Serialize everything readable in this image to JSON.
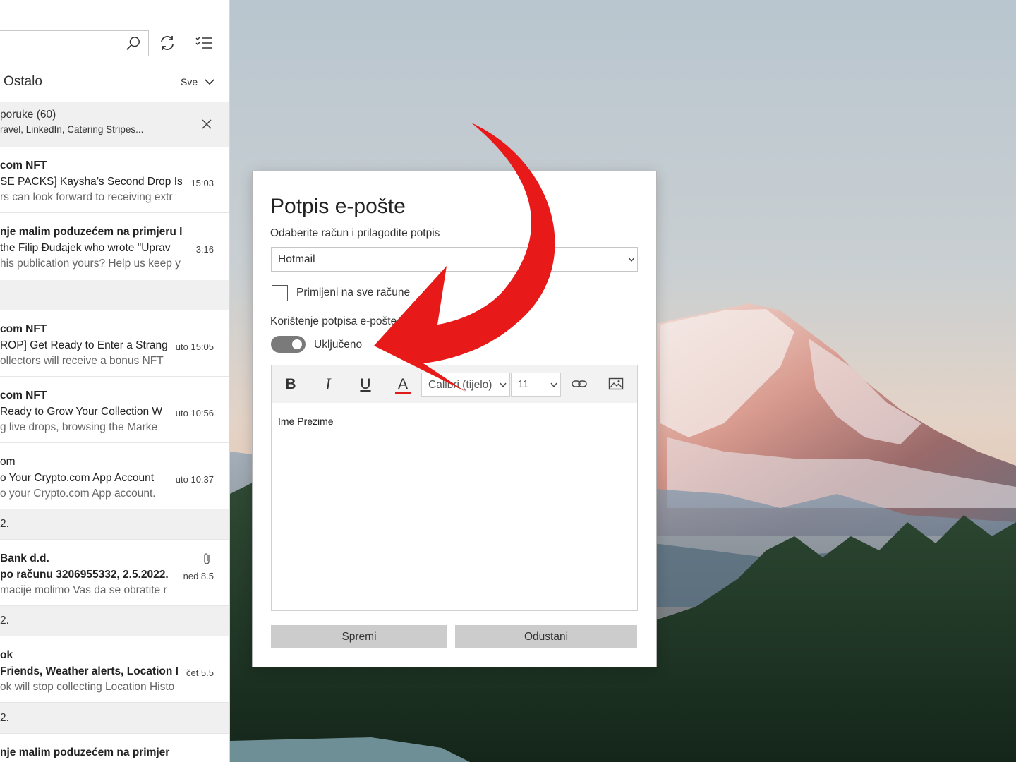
{
  "mail_list": {
    "tab_label": "Ostalo",
    "filter_label": "Sve",
    "grouped": {
      "title": "poruke (60)",
      "senders": "ravel, LinkedIn, Catering Stripes..."
    },
    "items": [
      {
        "sender": "com NFT",
        "subject": "SE PACKS] Kaysha’s Second Drop Is",
        "time": "15:03",
        "preview": "rs can look forward to receiving extr"
      },
      {
        "sender": "nje malim poduzećem na primjeru I",
        "subject": "the Filip Đudajek who wrote \"Uprav",
        "time": "3:16",
        "preview": "his publication yours? Help us keep y"
      },
      {
        "sender": "com NFT",
        "subject": "ROP] Get Ready to Enter a Strang",
        "time": "uto 15:05",
        "preview": "ollectors will receive a bonus NFT"
      },
      {
        "sender": "com NFT",
        "subject": "Ready to Grow Your Collection W",
        "time": "uto 10:56",
        "preview": "g live drops, browsing the Marke"
      },
      {
        "sender": "om",
        "subject": "o Your Crypto.com App Account",
        "time": "uto 10:37",
        "preview": "o your Crypto.com App account."
      },
      {
        "sender": "Bank d.d.",
        "subject": "po računu 3206955332, 2.5.2022.",
        "time": "ned 8.5",
        "preview": "macije molimo Vas da se obratite r"
      },
      {
        "sender": "ok",
        "subject": "Friends, Weather alerts, Location I",
        "time": "čet 5.5",
        "preview": "ok will stop collecting Location Histo"
      },
      {
        "sender": "nje malim poduzećem na primjer",
        "subject": "",
        "time": "",
        "preview": ""
      }
    ],
    "date_headers": [
      "2.",
      "2.",
      "2."
    ]
  },
  "dialog": {
    "title": "Potpis e-pošte",
    "subtitle": "Odaberite račun i prilagodite potpis",
    "account": "Hotmail",
    "apply_all_label": "Primijeni na sve račune",
    "usage_label": "Korištenje potpisa e-pošte",
    "toggle_label": "Uključeno",
    "toolbar": {
      "bold": "B",
      "italic": "I",
      "underline": "U",
      "font_color": "A",
      "font": "Calibri (tijelo)",
      "size": "11"
    },
    "signature_text": "Ime Prezime",
    "save_label": "Spremi",
    "cancel_label": "Odustani"
  },
  "colors": {
    "annotation_arrow": "#e81919",
    "font_color_bar": "#e01b1b"
  }
}
